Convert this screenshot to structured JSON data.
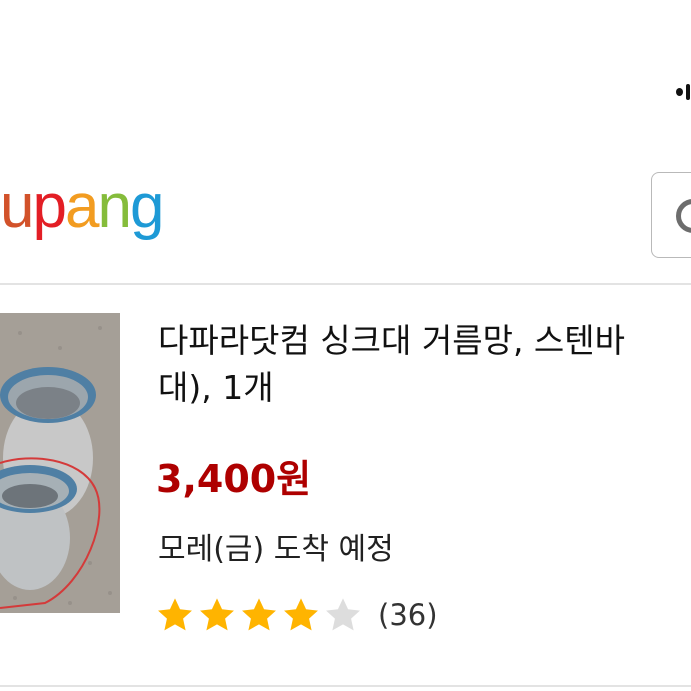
{
  "header": {
    "logo_letters": [
      {
        "char": "u",
        "color": "#d2522a"
      },
      {
        "char": "p",
        "color": "#e31e25"
      },
      {
        "char": "a",
        "color": "#f29c21"
      },
      {
        "char": "n",
        "color": "#85bc3b"
      },
      {
        "char": "g",
        "color": "#1e9ad6"
      }
    ],
    "search_icon": "search-icon"
  },
  "product": {
    "title_line1": "다파라닷컴 싱크대 거름망, 스텐바",
    "title_line2": "대), 1개",
    "price": "3,400원",
    "delivery": "모레(금) 도착 예정",
    "rating": 4,
    "rating_max": 5,
    "review_count": "(36)",
    "colors": {
      "price": "#ae0000",
      "star_filled": "#ffb400",
      "star_empty": "#dddddd"
    }
  }
}
